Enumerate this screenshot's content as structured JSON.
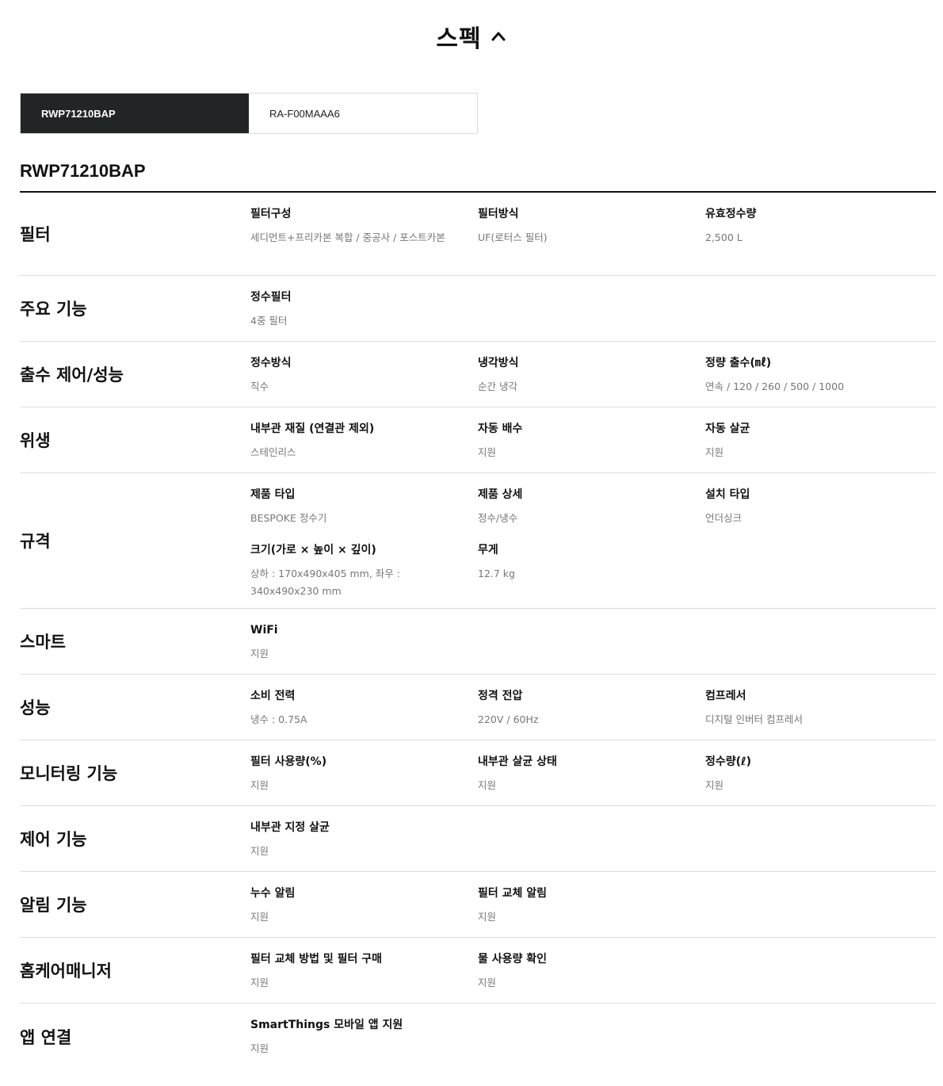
{
  "header": {
    "title": "스펙"
  },
  "tabs": [
    {
      "label": "RWP71210BAP"
    },
    {
      "label": "RA-F00MAAA6"
    }
  ],
  "model_title": "RWP71210BAP",
  "specs": [
    {
      "category": "필터",
      "items": [
        {
          "label": "필터구성",
          "value": "세디먼트+프리카본 복합 / 중공사 / 포스트카본"
        },
        {
          "label": "필터방식",
          "value": "UF(로터스 필터)"
        },
        {
          "label": "유효정수량",
          "value": "2,500 L"
        }
      ]
    },
    {
      "category": "주요 기능",
      "items": [
        {
          "label": "정수필터",
          "value": "4중 필터"
        }
      ]
    },
    {
      "category": "출수 제어/성능",
      "items": [
        {
          "label": "정수방식",
          "value": "직수"
        },
        {
          "label": "냉각방식",
          "value": "순간 냉각"
        },
        {
          "label": "정량 출수(㎖)",
          "value": "연속 / 120 / 260 / 500 / 1000"
        }
      ]
    },
    {
      "category": "위생",
      "items": [
        {
          "label": "내부관 재질 (연결관 제외)",
          "value": "스테인리스"
        },
        {
          "label": "자동 배수",
          "value": "지원"
        },
        {
          "label": "자동 살균",
          "value": "지원"
        }
      ]
    },
    {
      "category": "규격",
      "items": [
        {
          "label": "제품 타입",
          "value": "BESPOKE 정수기"
        },
        {
          "label": "제품 상세",
          "value": "정수/냉수"
        },
        {
          "label": "설치 타입",
          "value": "언더싱크"
        },
        {
          "label": "크기(가로 × 높이 × 깊이)",
          "value": "상하 : 170x490x405 mm, 좌우 : 340x490x230 mm"
        },
        {
          "label": "무게",
          "value": "12.7 kg"
        }
      ]
    },
    {
      "category": "스마트",
      "items": [
        {
          "label": "WiFi",
          "value": "지원"
        }
      ]
    },
    {
      "category": "성능",
      "items": [
        {
          "label": "소비 전력",
          "value": "냉수 : 0.75A"
        },
        {
          "label": "정격 전압",
          "value": "220V / 60Hz"
        },
        {
          "label": "컴프레서",
          "value": "디지털 인버터 컴프레서"
        }
      ]
    },
    {
      "category": "모니터링 기능",
      "items": [
        {
          "label": "필터 사용량(%)",
          "value": "지원"
        },
        {
          "label": "내부관 살균 상태",
          "value": "지원"
        },
        {
          "label": "정수량(ℓ)",
          "value": "지원"
        }
      ]
    },
    {
      "category": "제어 기능",
      "items": [
        {
          "label": "내부관 지정 살균",
          "value": "지원"
        }
      ]
    },
    {
      "category": "알림 기능",
      "items": [
        {
          "label": "누수 알림",
          "value": "지원"
        },
        {
          "label": "필터 교체 알림",
          "value": "지원"
        }
      ]
    },
    {
      "category": "홈케어매니저",
      "items": [
        {
          "label": "필터 교체 방법 및 필터 구매",
          "value": "지원"
        },
        {
          "label": "물 사용량 확인",
          "value": "지원"
        }
      ]
    },
    {
      "category": "앱 연결",
      "items": [
        {
          "label": "SmartThings 모바일 앱 지원",
          "value": "지원"
        }
      ]
    }
  ]
}
